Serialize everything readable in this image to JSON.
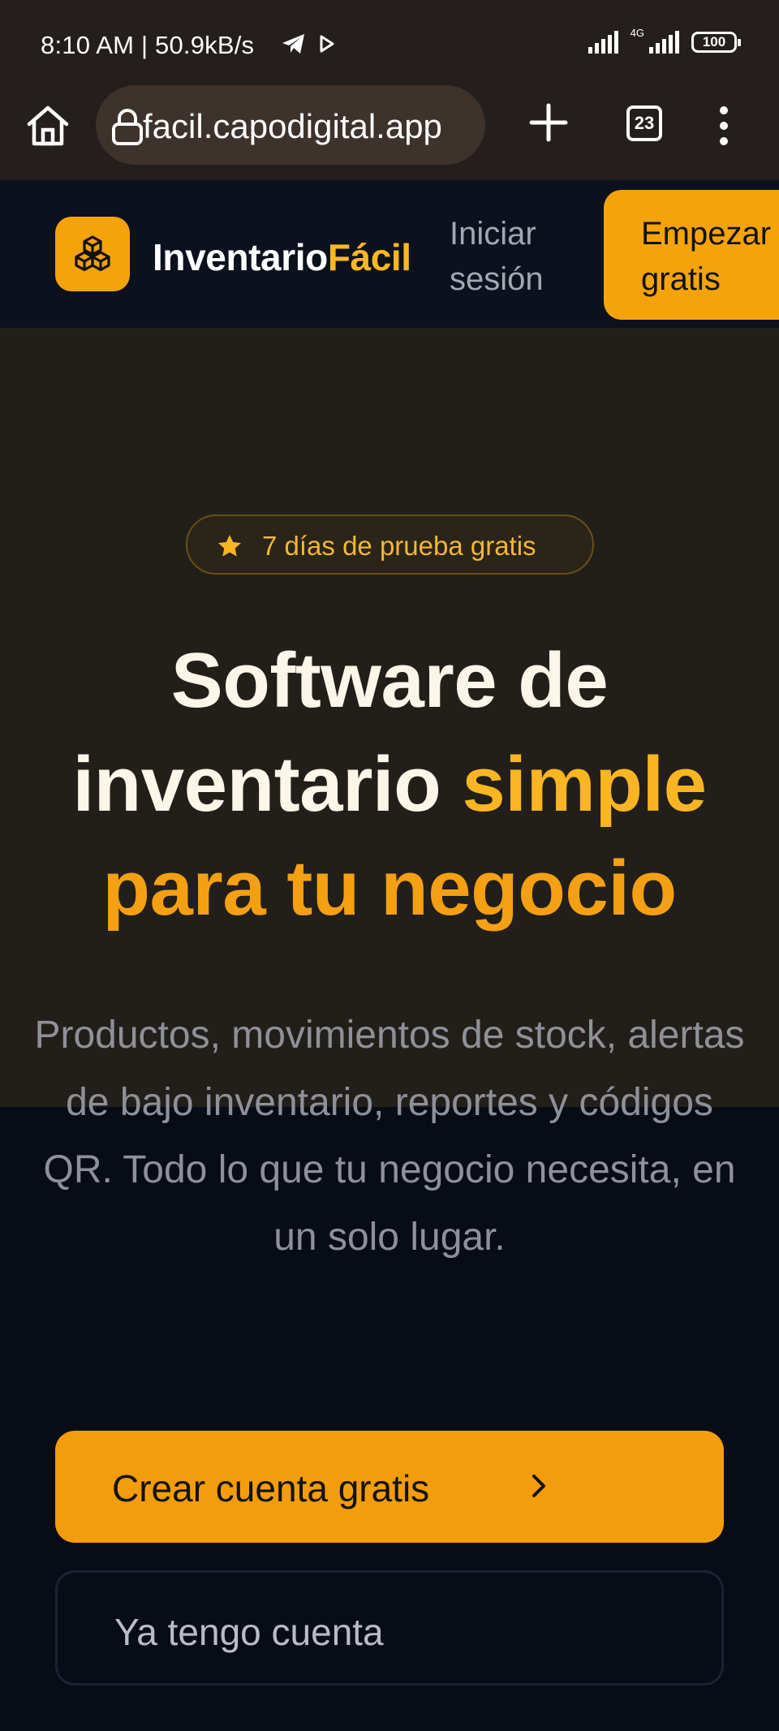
{
  "status_bar": {
    "time_speed": "8:10 AM | 50.9kB/s",
    "network": "4G",
    "battery": "100",
    "icons": [
      "telegram-icon",
      "play-icon",
      "signal-icon",
      "signal-icon",
      "battery-icon"
    ]
  },
  "browser": {
    "url": "facil.capodigital.app",
    "tab_count": "23",
    "icons": [
      "home-icon",
      "lock-icon",
      "plus-icon",
      "more-icon"
    ]
  },
  "header": {
    "brand_part1": "Inventario",
    "brand_part2": "Fácil",
    "login_label": "Iniciar sesión",
    "start_label": "Empezar gratis",
    "logo_icon": "boxes-icon"
  },
  "hero": {
    "badge": "7 días de prueba gratis",
    "badge_icon": "star-icon",
    "headline_line1": "Software de",
    "headline_part2_white": "inventario ",
    "headline_part2_accent": "simple",
    "headline_line3": "para tu negocio",
    "subtext": "Productos, movimientos de stock, alertas de bajo inventario, reportes y códigos QR. Todo lo que tu negocio necesita, en un solo lugar.",
    "cta_primary": "Crear cuenta gratis",
    "cta_secondary": "Ya tengo cuenta"
  },
  "colors": {
    "accent": "#f5a30b",
    "accent_light": "#f9b522",
    "page_bg": "#080c16",
    "hero_bg": "#221f1b",
    "header_bg": "#0b111d",
    "browser_bg": "#241f1c"
  }
}
